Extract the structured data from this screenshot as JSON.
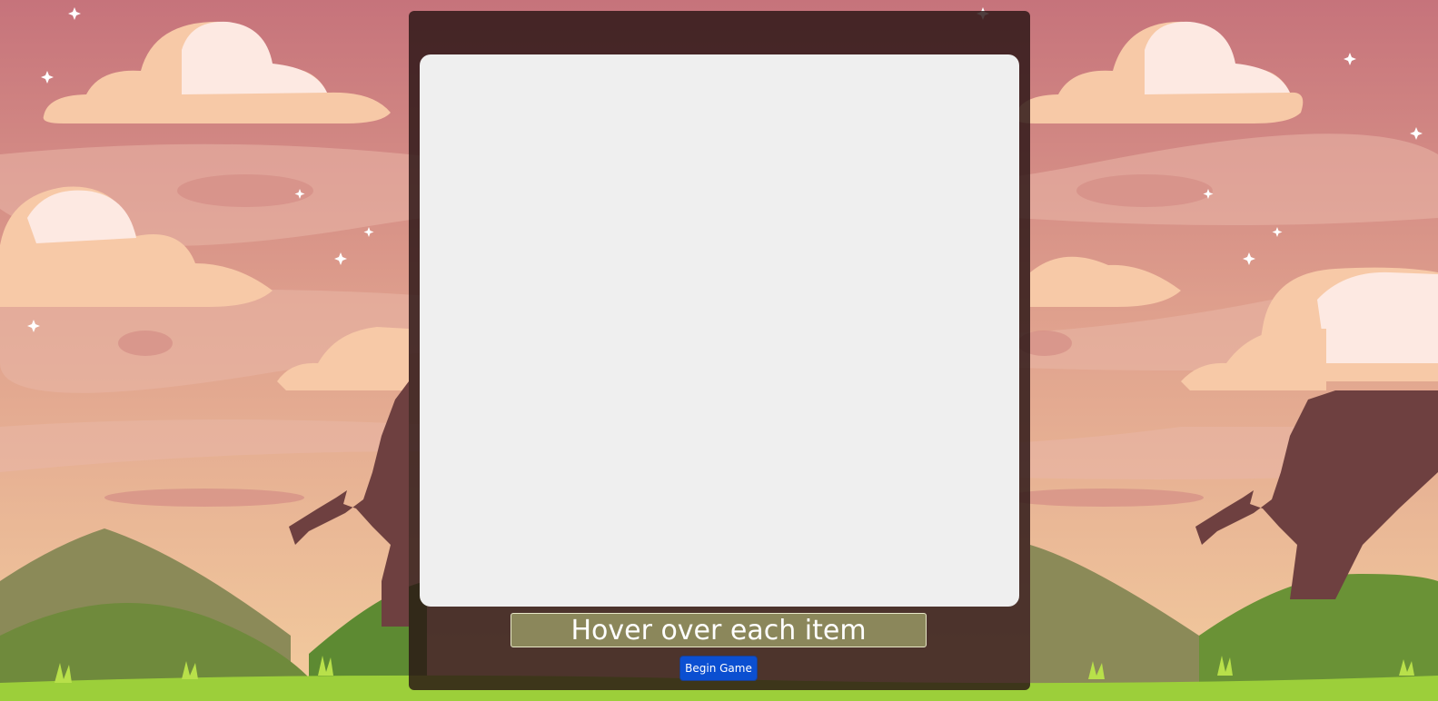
{
  "game": {
    "hint_text": "Hover over each item",
    "begin_button_label": "Begin Game"
  },
  "colors": {
    "sky_top": "#c97a80",
    "sky_bottom": "#f1c59a",
    "cloud": "#fde9e2",
    "hill": "#6f8a3c",
    "grass": "#8cc23a",
    "dragon": "#6e4040",
    "board": "#efefef",
    "button": "#0b4fd1"
  }
}
